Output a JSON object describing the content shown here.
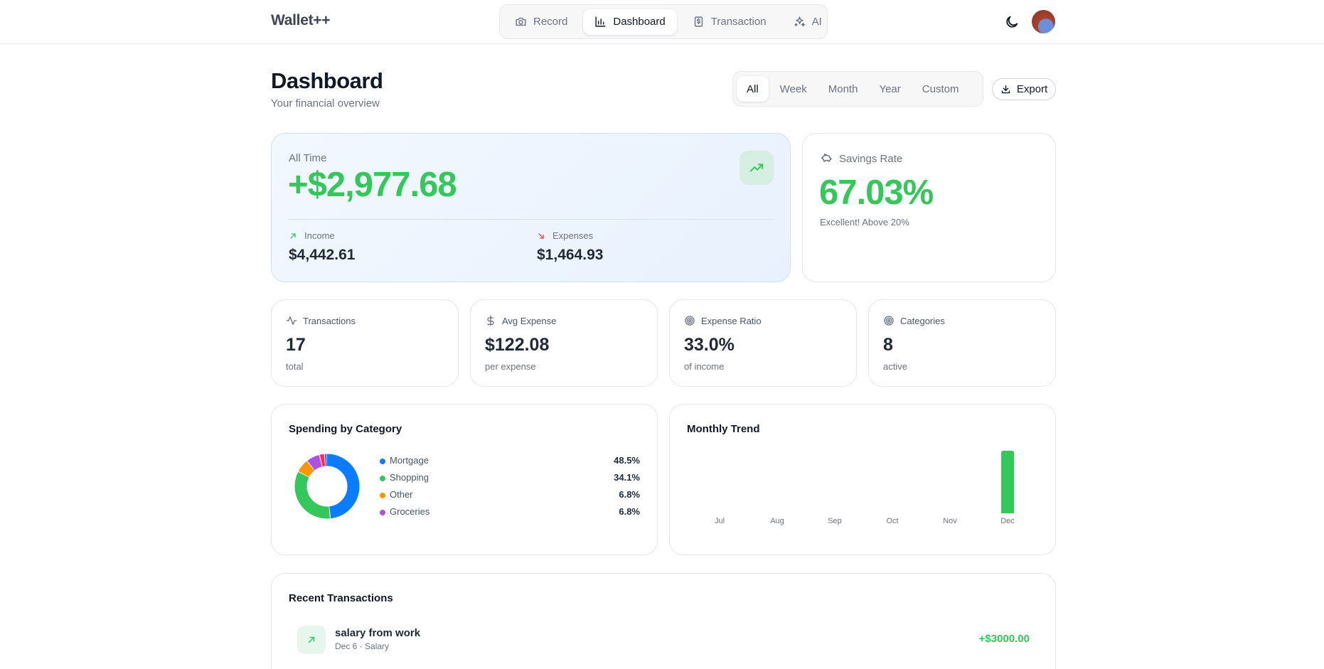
{
  "app": {
    "brand": "Wallet++"
  },
  "nav": {
    "items": [
      {
        "label": "Record",
        "icon": "camera-icon",
        "active": false
      },
      {
        "label": "Dashboard",
        "icon": "bar-chart-icon",
        "active": true
      },
      {
        "label": "Transaction",
        "icon": "receipt-icon",
        "active": false
      },
      {
        "label": "AI",
        "icon": "sparkles-icon",
        "active": false
      }
    ]
  },
  "header": {
    "title": "Dashboard",
    "subtitle": "Your financial overview",
    "ranges": [
      "All",
      "Week",
      "Month",
      "Year",
      "Custom"
    ],
    "active_range": "All",
    "export_label": "Export"
  },
  "summary": {
    "label": "All Time",
    "net": "+$2,977.68",
    "income_label": "Income",
    "income": "$4,442.61",
    "expenses_label": "Expenses",
    "expenses": "$1,464.93"
  },
  "savings": {
    "label": "Savings Rate",
    "value": "67.03%",
    "note": "Excellent! Above 20%"
  },
  "stats": [
    {
      "label": "Transactions",
      "value": "17",
      "note": "total",
      "icon": "activity-icon"
    },
    {
      "label": "Avg Expense",
      "value": "$122.08",
      "note": "per expense",
      "icon": "dollar-icon"
    },
    {
      "label": "Expense Ratio",
      "value": "33.0%",
      "note": "of income",
      "icon": "target-icon"
    },
    {
      "label": "Categories",
      "value": "8",
      "note": "active",
      "icon": "target-icon"
    }
  ],
  "spending": {
    "title": "Spending by Category",
    "legend": [
      {
        "name": "Mortgage",
        "pct": "48.5%",
        "color": "#0a7cff"
      },
      {
        "name": "Shopping",
        "pct": "34.1%",
        "color": "#34c759"
      },
      {
        "name": "Other",
        "pct": "6.8%",
        "color": "#ff9500"
      },
      {
        "name": "Groceries",
        "pct": "6.8%",
        "color": "#af52de"
      }
    ]
  },
  "trend": {
    "title": "Monthly Trend"
  },
  "chart_data": [
    {
      "type": "pie",
      "title": "Spending by Category",
      "categories": [
        "Mortgage",
        "Shopping",
        "Other",
        "Groceries",
        "(unlabeled)",
        "(unlabeled)"
      ],
      "values": [
        48.5,
        34.1,
        6.8,
        6.8,
        2.5,
        1.3
      ],
      "colors": [
        "#0a7cff",
        "#34c759",
        "#ff9500",
        "#af52de",
        "#ff2d55",
        "#5856d6"
      ],
      "donut": true
    },
    {
      "type": "bar",
      "title": "Monthly Trend",
      "categories": [
        "Jul",
        "Aug",
        "Sep",
        "Oct",
        "Nov",
        "Dec"
      ],
      "values": [
        0,
        0,
        0,
        0,
        0,
        1
      ],
      "color": "#34c759"
    }
  ],
  "recent": {
    "title": "Recent Transactions",
    "items": [
      {
        "name": "salary from work",
        "sub": "Dec 6 · Salary",
        "amount": "+$3000.00"
      }
    ]
  }
}
